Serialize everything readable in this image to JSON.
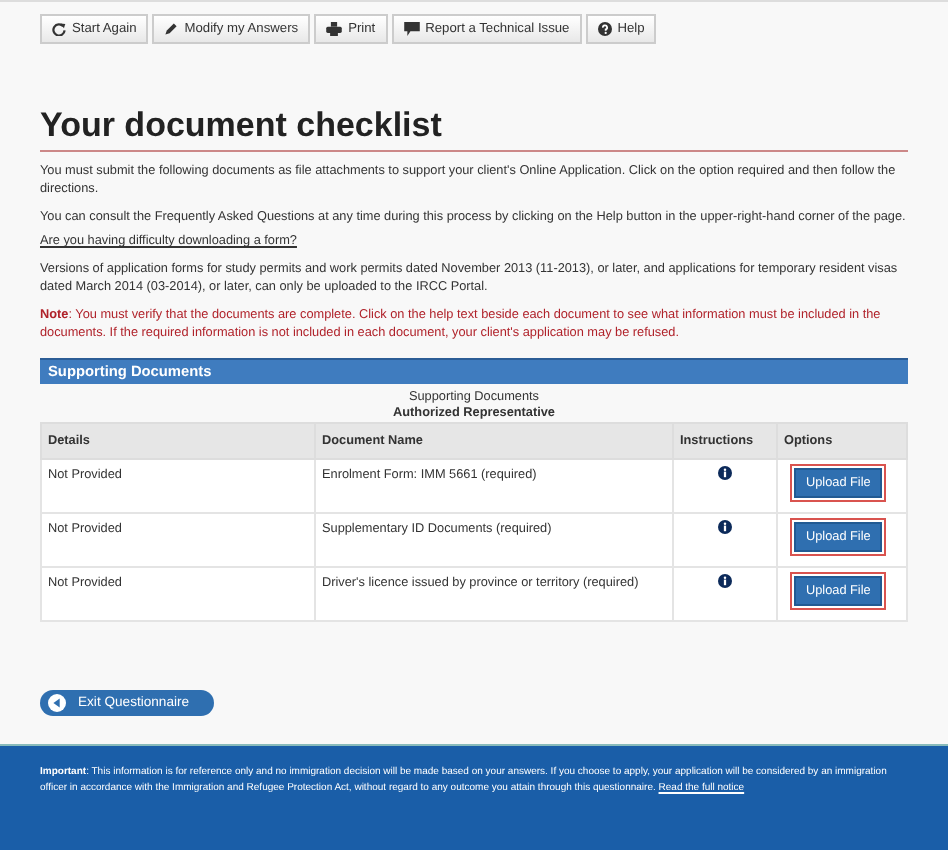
{
  "toolbar": [
    {
      "label": "Start Again"
    },
    {
      "label": "Modify my Answers"
    },
    {
      "label": "Print"
    },
    {
      "label": "Report a Technical Issue"
    },
    {
      "label": "Help"
    }
  ],
  "title": "Your document checklist",
  "paragraphs": [
    "You must submit the following documents as file attachments to support your client's Online Application. Click on the option required and then follow the directions.",
    "You can consult the Frequently Asked Questions at any time during this process by clicking on the Help button in the upper-right-hand corner of the page."
  ],
  "help_link": "Are you having difficulty downloading a form?",
  "versions_text": "Versions of application forms for study permits and work permits dated November 2013 (11-2013), or later, and applications for temporary resident visas dated March 2014 (03-2014), or later, can only be uploaded to the IRCC Portal.",
  "note": "**Note**: You must verify that the documents are complete. Click on the help text beside each document to see what information must be included in the documents. If the required information is not included in each document, your client's application may be refused.",
  "section_title": "Supporting Documents",
  "table": {
    "caption": "Supporting Documents",
    "subcaption": "Authorized Representative",
    "columns": [
      "Details",
      "Document Name",
      "Instructions",
      "Options"
    ],
    "rows": [
      {
        "details": "Not Provided",
        "document": "Enrolment Form: IMM 5661  (required)",
        "option": "Upload File"
      },
      {
        "details": "Not Provided",
        "document": "Supplementary ID Documents  (required)",
        "option": "Upload File"
      },
      {
        "details": "Not Provided",
        "document": "Driver's licence issued by province or territory  (required)",
        "option": "Upload File"
      }
    ]
  },
  "exit_button": "Exit Questionnaire",
  "footer": {
    "text": "**Important**: This information is for reference only and no immigration decision will be made based on your answers. If you choose to apply, your application will be considered by an immigration officer in accordance with the Immigration and Refugee Protection Act, without regard to any outcome you attain through this questionnaire.",
    "link": "Read the full notice"
  }
}
